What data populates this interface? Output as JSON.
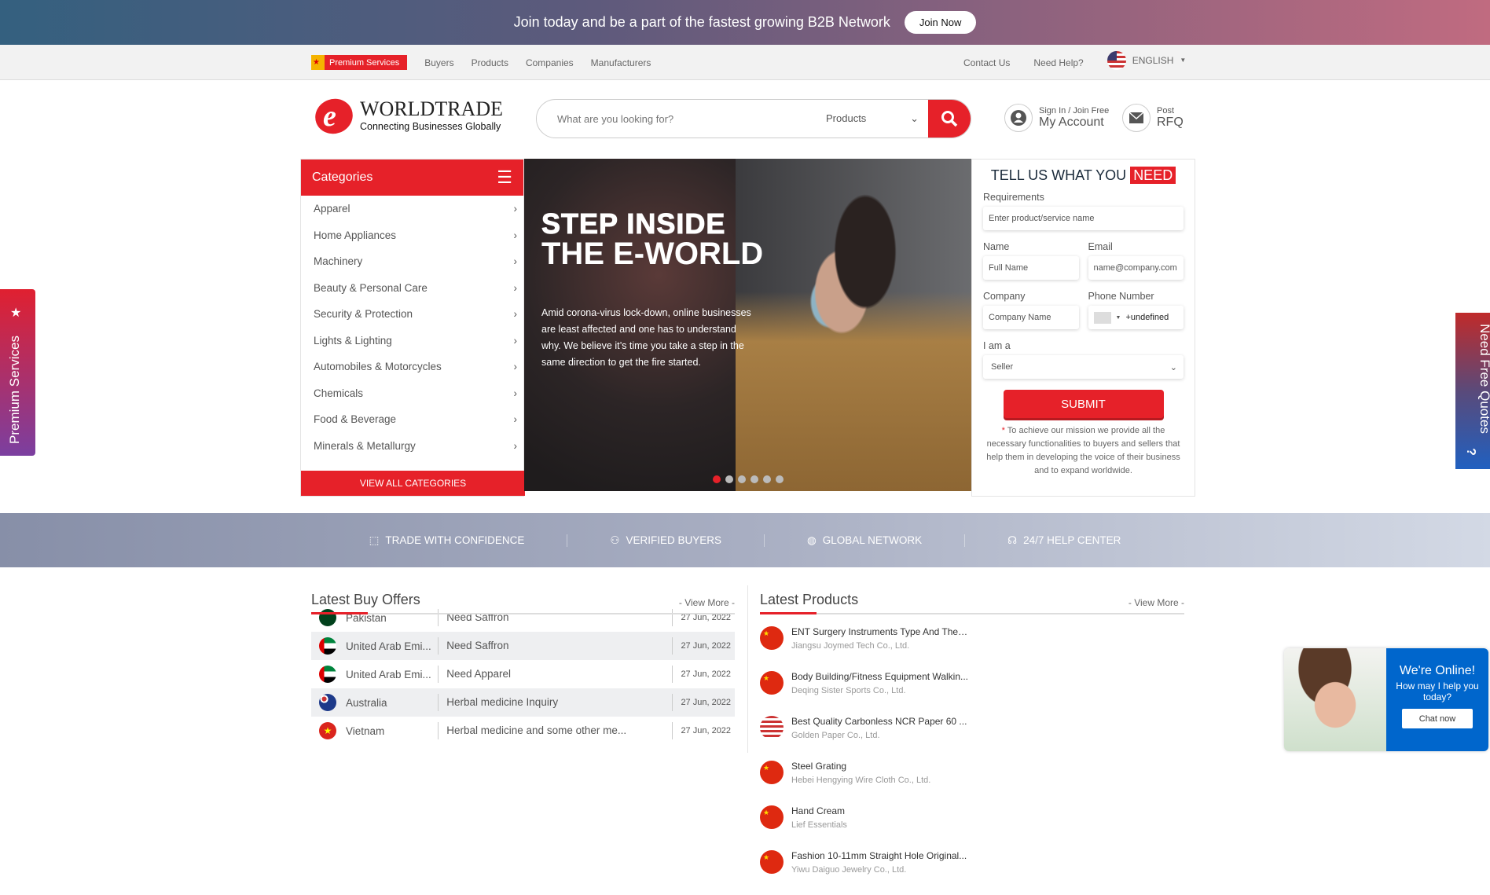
{
  "banner": {
    "text": "Join today and be a part of the fastest growing B2B Network",
    "join": "Join Now"
  },
  "nav": {
    "premium": "Premium Services",
    "links": [
      "Buyers",
      "Products",
      "Companies",
      "Manufacturers"
    ],
    "contact": "Contact Us",
    "help": "Need Help?",
    "language": "ENGLISH"
  },
  "logo": {
    "name": "WORLDTRADE",
    "letter": "e",
    "tagline": "Connecting Businesses Globally"
  },
  "search": {
    "placeholder": "What are you looking for?",
    "category": "Products"
  },
  "account": {
    "small": "Sign In / Join Free",
    "big": "My Account"
  },
  "rfq": {
    "small": "Post",
    "big": "RFQ"
  },
  "categories": {
    "title": "Categories",
    "items": [
      "Apparel",
      "Home Appliances",
      "Machinery",
      "Beauty & Personal Care",
      "Security & Protection",
      "Lights & Lighting",
      "Automobiles  & Motorcycles",
      "Chemicals",
      "Food & Beverage",
      "Minerals & Metallurgy"
    ],
    "view_all": "VIEW ALL CATEGORIES"
  },
  "hero": {
    "line1": "STEP INSIDE",
    "line2": "THE E-WORLD",
    "body": "Amid corona-virus lock-down, online businesses are least affected and one has to understand why. We believe it’s time you take a step in the same direction to get the fire started.",
    "slides": 6,
    "active_slide": 1
  },
  "form": {
    "title": "TELL US WHAT YOU",
    "title_hl": "NEED",
    "req_label": "Requirements",
    "req_ph": "Enter product/service name",
    "name_label": "Name",
    "name_ph": "Full Name",
    "email_label": "Email",
    "email_ph": "name@company.com",
    "company_label": "Company",
    "company_ph": "Company Name",
    "phone_label": "Phone Number",
    "phone_val": "+undefined",
    "role_label": "I am a",
    "role_val": "Seller",
    "submit": "SUBMIT",
    "note_star": "*",
    "note": " To achieve our mission we provide all the necessary functionalities to buyers and sellers that help them in developing the voice of their business and to expand worldwide."
  },
  "features": [
    "TRADE WITH CONFIDENCE",
    "VERIFIED BUYERS",
    "GLOBAL NETWORK",
    "24/7 HELP CENTER"
  ],
  "buy_offers": {
    "title": "Latest Buy Offers",
    "view_more": "- View More -",
    "rows": [
      {
        "country": "Pakistan",
        "offer": "Need Saffron",
        "date": "27 Jun, 2022",
        "flag": "pk"
      },
      {
        "country": "United Arab Emi...",
        "offer": "Need Saffron",
        "date": "27 Jun, 2022",
        "flag": "uae"
      },
      {
        "country": "United Arab Emi...",
        "offer": "Need Apparel",
        "date": "27 Jun, 2022",
        "flag": "uae"
      },
      {
        "country": "Australia",
        "offer": "Herbal medicine Inquiry",
        "date": "27 Jun, 2022",
        "flag": "aus"
      },
      {
        "country": "Vietnam",
        "offer": "Herbal medicine and some other me...",
        "date": "27 Jun, 2022",
        "flag": "vn"
      }
    ]
  },
  "products": {
    "title": "Latest Products",
    "view_more": "- View More -",
    "items": [
      {
        "name": "ENT Surgery Instruments Type And The ...",
        "company": "Jiangsu Joymed Tech Co., Ltd.",
        "flag": "cn"
      },
      {
        "name": "Body Building/Fitness Equipment Walkin...",
        "company": "Deqing Sister Sports Co., Ltd.",
        "flag": "cn"
      },
      {
        "name": "Best Quality Carbonless NCR Paper 60 ...",
        "company": "Golden Paper Co., Ltd.",
        "flag": "us"
      },
      {
        "name": "Steel Grating",
        "company": "Hebei Hengying Wire Cloth Co., Ltd.",
        "flag": "cn"
      },
      {
        "name": "Hand Cream",
        "company": "Lief Essentials",
        "flag": "cn"
      },
      {
        "name": "Fashion 10-11mm Straight Hole Original...",
        "company": "Yiwu Daiguo Jewelry Co., Ltd.",
        "flag": "cn"
      }
    ]
  },
  "side_tabs": {
    "premium": "Premium Services",
    "quotes": "Need Free Quotes"
  },
  "chat": {
    "title": "We're Online!",
    "sub": "How may I help you today?",
    "button": "Chat now"
  },
  "colors": {
    "brand_red": "#e62129",
    "chat_blue": "#0066cc"
  }
}
